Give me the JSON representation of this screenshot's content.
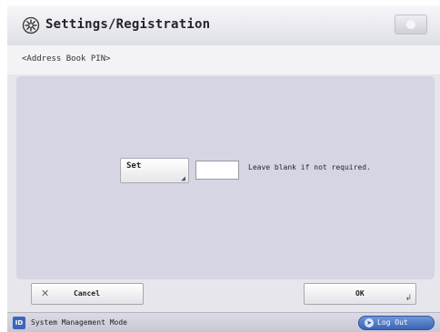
{
  "header": {
    "title": "Settings/Registration",
    "icon": "settings-icon",
    "corner_icon": "toggle-icon"
  },
  "subheader": {
    "label": "<Address Book PIN>"
  },
  "pin_form": {
    "set_button_label": "Set",
    "pin_value": "",
    "hint": "Leave blank if not required."
  },
  "footer_buttons": {
    "cancel_label": "Cancel",
    "ok_label": "OK"
  },
  "statusbar": {
    "mode_icon_text": "ID",
    "mode_text": "System Management Mode",
    "logout_label": "Log Out"
  },
  "colors": {
    "background": "#e6e6ec",
    "panel": "#d5d5e3",
    "logout_button": "#3b64b4",
    "id_icon": "#3d66b8"
  }
}
